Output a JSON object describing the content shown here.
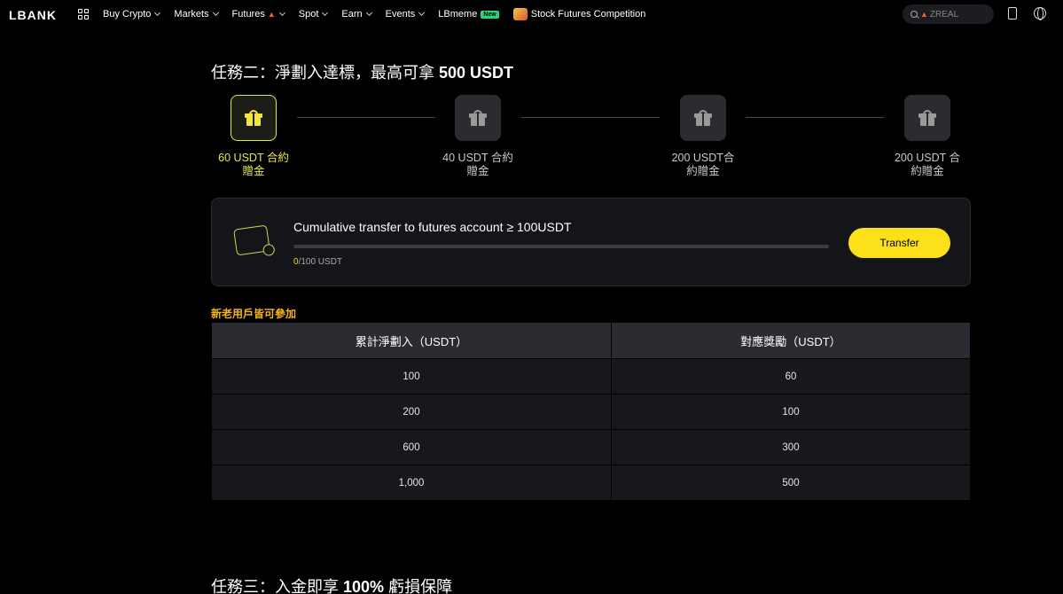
{
  "header": {
    "logo": "LBANK",
    "nav": [
      {
        "label": "Buy Crypto"
      },
      {
        "label": "Markets"
      },
      {
        "label": "Futures"
      },
      {
        "label": "Spot"
      },
      {
        "label": "Earn"
      },
      {
        "label": "Events"
      },
      {
        "label": "LBmeme",
        "badge": "New"
      },
      {
        "label": "Stock Futures Competition"
      }
    ],
    "search": {
      "value": "ZREAL"
    }
  },
  "task2": {
    "title_prefix": "任務二：淨劃入達標，最高可拿 ",
    "title_bold": "500 USDT",
    "steps": [
      {
        "line1": "60 USDT 合約",
        "line2": "贈金",
        "active": true
      },
      {
        "line1": "40 USDT 合約",
        "line2": "贈金",
        "active": false
      },
      {
        "line1": "200 USDT合",
        "line2": "約贈金",
        "active": false
      },
      {
        "line1": "200 USDT 合",
        "line2": "約贈金",
        "active": false
      }
    ]
  },
  "transfer_card": {
    "title": "Cumulative transfer to futures account ≥ 100USDT",
    "progress_current": "0",
    "progress_total": "/100 USDT",
    "progress_fraction": 0,
    "button_label": "Transfer"
  },
  "eligibility": "新老用戶皆可參加",
  "reward_table": {
    "headers": [
      "累計淨劃入（USDT）",
      "對應獎勵（USDT）"
    ],
    "rows": [
      [
        "100",
        "60"
      ],
      [
        "200",
        "100"
      ],
      [
        "600",
        "300"
      ],
      [
        "1,000",
        "500"
      ]
    ]
  },
  "task3": {
    "title_prefix": "任務三：入金即享 ",
    "title_bold": "100%",
    "title_suffix": " 虧損保障"
  },
  "colors": {
    "accent_yellow": "#fce11a",
    "active_step": "#e4e846",
    "eligibility": "#f3b51a"
  }
}
